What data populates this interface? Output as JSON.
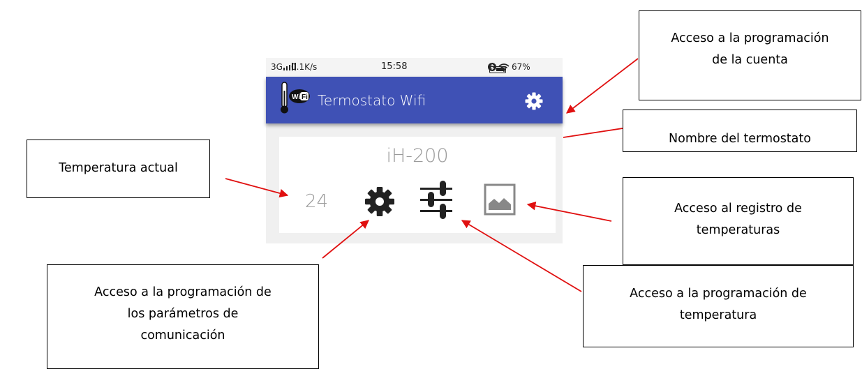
{
  "statusbar": {
    "signal": "3G",
    "speed": "0.1K/s",
    "time": "15:58",
    "battery": "67%",
    "icons": [
      "bluetooth-icon",
      "wifi-icon",
      "battery-icon"
    ]
  },
  "app": {
    "logo_text": "WiFi",
    "title": "Termostato Wifi",
    "header_color": "#3f51b5"
  },
  "device": {
    "name": "iH-200",
    "temperature": "24",
    "actions": [
      "gear-icon",
      "sliders-icon",
      "image-icon"
    ]
  },
  "callouts": {
    "account": [
      "Acceso a la programación",
      "de la cuenta"
    ],
    "name": [
      "Nombre del termostato"
    ],
    "current_temp": [
      "Temperatura actual"
    ],
    "log": [
      "Acceso al registro de",
      "temperaturas"
    ],
    "comm": [
      "Acceso a la programación de",
      "los parámetros de",
      "comunicación"
    ],
    "temp_prog": [
      "Acceso a la programación de",
      "temperatura"
    ]
  },
  "arrow_color": "#e01010"
}
